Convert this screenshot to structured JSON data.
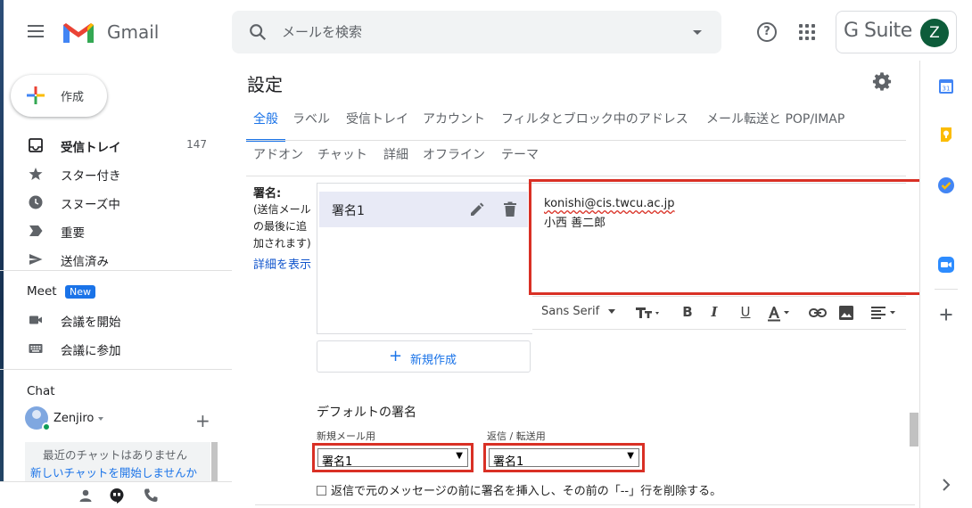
{
  "header": {
    "app_name": "Gmail",
    "search_placeholder": "メールを検索",
    "brand": "G Suite",
    "avatar_initial": "Z"
  },
  "sidebar": {
    "compose_label": "作成",
    "items": [
      {
        "label": "受信トレイ",
        "count": "147",
        "icon": "inbox-icon"
      },
      {
        "label": "スター付き",
        "count": "",
        "icon": "star-icon"
      },
      {
        "label": "スヌーズ中",
        "count": "",
        "icon": "clock-icon"
      },
      {
        "label": "重要",
        "count": "",
        "icon": "label-important-icon"
      },
      {
        "label": "送信済み",
        "count": "",
        "icon": "send-icon"
      }
    ],
    "meet": {
      "title": "Meet",
      "badge": "New",
      "items": [
        {
          "label": "会議を開始",
          "icon": "video-camera-icon"
        },
        {
          "label": "会議に参加",
          "icon": "keyboard-icon"
        }
      ]
    },
    "chat": {
      "title": "Chat",
      "user": "Zenjiro",
      "empty_text": "最近のチャットはありません",
      "start_link": "新しいチャットを開始しませんか"
    }
  },
  "settings": {
    "title": "設定",
    "tabs_row1": [
      "全般",
      "ラベル",
      "受信トレイ",
      "アカウント",
      "フィルタとブロック中のアドレス",
      "メール転送と POP/IMAP"
    ],
    "tabs_row2": [
      "アドオン",
      "チャット",
      "詳細",
      "オフライン",
      "テーマ"
    ],
    "active_tab": "全般",
    "signature": {
      "label": "署名:",
      "help_lines": [
        "(送信メール",
        "の最後に追",
        "加されます)"
      ],
      "more_link": "詳細を表示",
      "list": [
        {
          "name": "署名1"
        }
      ],
      "editor_lines": [
        "konishi@cis.twcu.ac.jp",
        "小西 善二郎"
      ],
      "toolbar_font": "Sans Serif",
      "new_button": "新規作成",
      "default_title": "デフォルトの署名",
      "new_mail_label": "新規メール用",
      "new_mail_value": "署名1",
      "reply_label": "返信 / 転送用",
      "reply_value": "署名1",
      "insert_before_quote": "返信で元のメッセージの前に署名を挿入し、その前の「--」行を削除する。"
    }
  },
  "colors": {
    "accent": "#1a73e8",
    "highlight_box": "#d93025",
    "selected_signature_bg": "#e8eaf6",
    "avatar_bg": "#0d5c3a"
  }
}
